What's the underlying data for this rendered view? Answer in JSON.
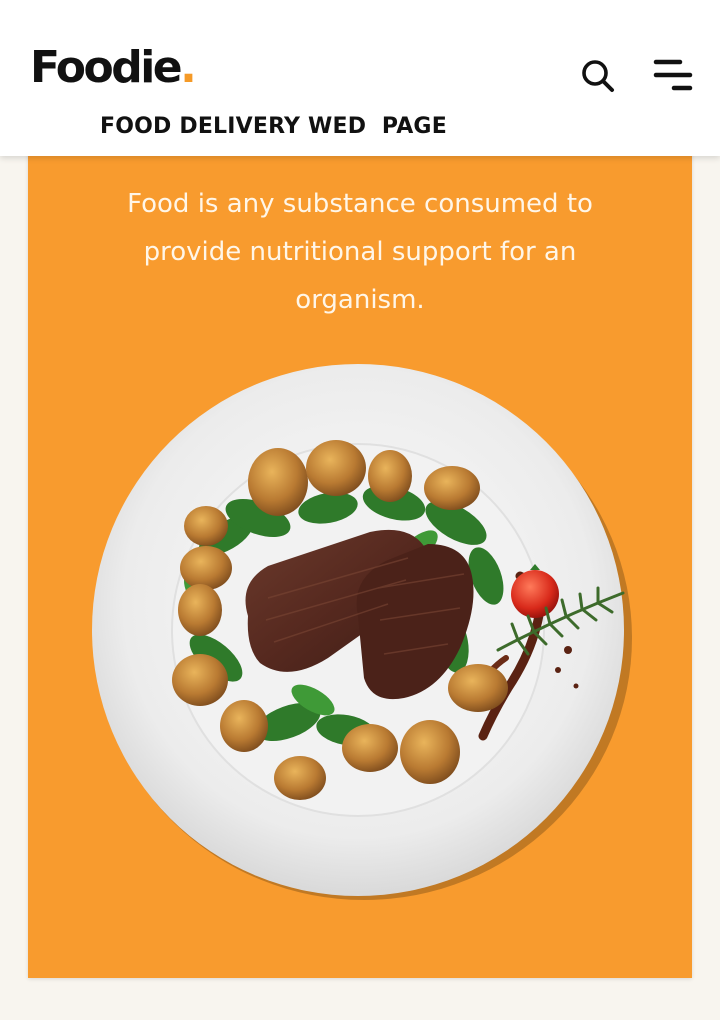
{
  "header": {
    "logo_text": "Foodie",
    "logo_dot": ".",
    "subtitle": "FOOD DELIVERY WED  PAGE",
    "icons": {
      "search": "search-icon",
      "menu": "menu-icon"
    }
  },
  "hero": {
    "description": "Food is any substance consumed to provide nutritional support for an organism.",
    "image": "plate-of-steak-with-potatoes-spinach-tomato-and-rosemary"
  },
  "colors": {
    "brand_orange": "#f89b2e",
    "logo_accent": "#f59a27",
    "header_bg": "#ffffff",
    "page_bg": "#f8f5ef",
    "text_dark": "#111111"
  }
}
